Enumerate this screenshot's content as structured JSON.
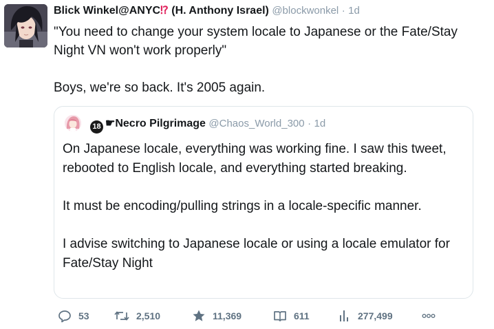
{
  "tweet": {
    "author_name": "Blick Winkel@ANYC",
    "author_badge": "⁉",
    "author_paren": "(H. Anthony Israel)",
    "handle": "@blockwonkel",
    "separator": "·",
    "time": "1d",
    "text": "\"You need to change your system locale to Japanese or the Fate/Stay Night VN won't work properly\"\n\nBoys, we're so back. It's 2005 again."
  },
  "quote": {
    "badge": "18",
    "name": "☛Necro Pilgrimage",
    "handle": "@Chaos_World_300",
    "separator": "·",
    "time": "1d",
    "text": "On Japanese locale, everything was working fine. I saw this tweet, rebooted to English locale, and everything started breaking.\n\nIt must be encoding/pulling strings in a locale-specific manner.\n\nI advise switching to Japanese locale or using a locale emulator for Fate/Stay Night"
  },
  "actions": {
    "replies": "53",
    "retweets": "2,510",
    "likes": "11,369",
    "reads": "611",
    "views": "277,499"
  },
  "icons": {
    "reply": "reply-icon",
    "retweet": "retweet-icon",
    "like": "star-icon",
    "read": "book-icon",
    "views": "bar-chart-icon",
    "more": "more-icon"
  },
  "colors": {
    "text": "#14171a",
    "muted": "#8a9aa8",
    "action": "#5f7282",
    "badge_red": "#e0245e",
    "border": "#dfe6ea"
  }
}
